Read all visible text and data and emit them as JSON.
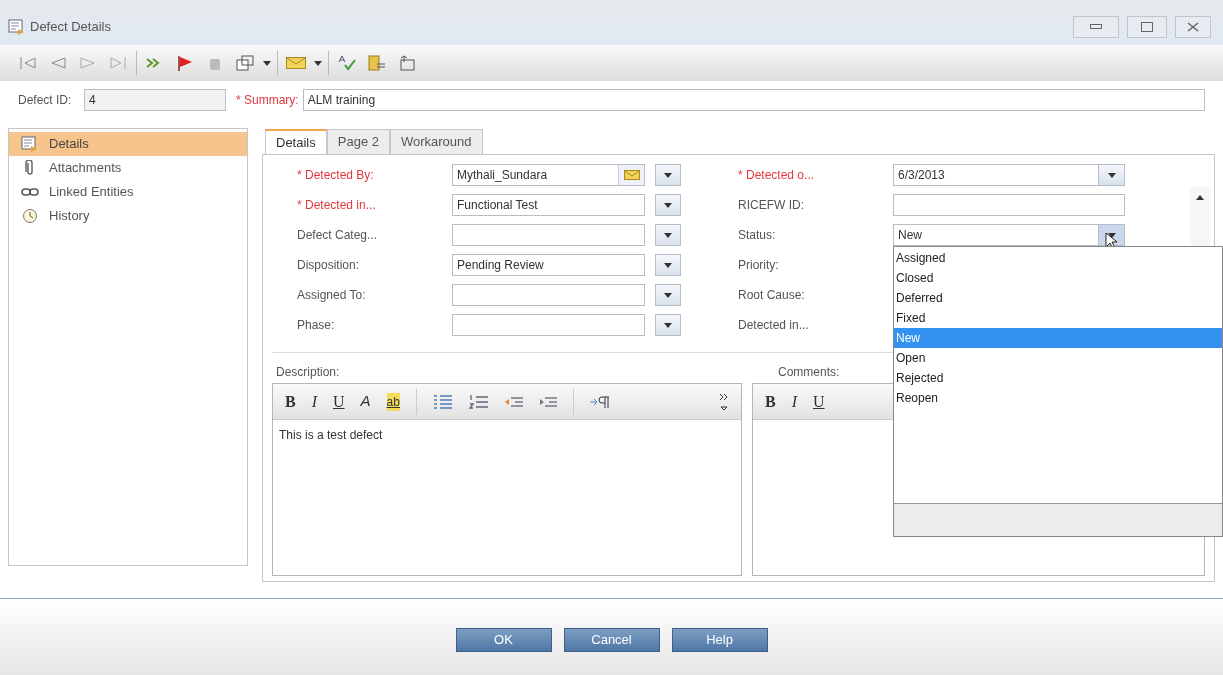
{
  "window": {
    "title": "Defect Details"
  },
  "header": {
    "id_label": "Defect ID:",
    "id_value": "4",
    "summary_label": "* Summary:",
    "summary_value": "ALM training"
  },
  "sidebar": {
    "items": [
      {
        "label": "Details",
        "kind": "details",
        "selected": true
      },
      {
        "label": "Attachments",
        "kind": "attachment",
        "selected": false
      },
      {
        "label": "Linked Entities",
        "kind": "link",
        "selected": false
      },
      {
        "label": "History",
        "kind": "history",
        "selected": false
      }
    ]
  },
  "tabs": [
    {
      "label": "Details",
      "selected": true
    },
    {
      "label": "Page 2",
      "selected": false
    },
    {
      "label": "Workaround",
      "selected": false
    }
  ],
  "left_fields": [
    {
      "label": "* Detected By:",
      "required": true,
      "kind": "user",
      "value": "Mythali_Sundara"
    },
    {
      "label": "* Detected in...",
      "required": true,
      "kind": "dropdown",
      "value": "Functional Test"
    },
    {
      "label": "Defect Categ...",
      "required": false,
      "kind": "dropdown"
    },
    {
      "label": "Disposition:",
      "required": false,
      "kind": "dropdown",
      "value": "Pending Review"
    },
    {
      "label": "Assigned To:",
      "required": false,
      "kind": "dropdown"
    },
    {
      "label": "Phase:",
      "required": false,
      "kind": "dropdown"
    }
  ],
  "right_fields": [
    {
      "label": "* Detected o...",
      "required": true,
      "kind": "dropdown",
      "value": "6/3/2013"
    },
    {
      "label": "RICEFW ID:",
      "required": false,
      "kind": "text"
    },
    {
      "label": "Status:",
      "required": false,
      "kind": "open_dropdown",
      "value": "New"
    },
    {
      "label": "Priority:",
      "required": false,
      "kind": "hidden"
    },
    {
      "label": "Root Cause:",
      "required": false,
      "kind": "hidden"
    },
    {
      "label": "Detected in...",
      "required": false,
      "kind": "hidden"
    }
  ],
  "status_options": [
    {
      "label": "Assigned",
      "selected": false
    },
    {
      "label": "Closed",
      "selected": false
    },
    {
      "label": "Deferred",
      "selected": false
    },
    {
      "label": "Fixed",
      "selected": false
    },
    {
      "label": "New",
      "selected": true
    },
    {
      "label": "Open",
      "selected": false
    },
    {
      "label": "Rejected",
      "selected": false
    },
    {
      "label": "Reopen",
      "selected": false
    }
  ],
  "description": {
    "label": "Description:",
    "toolbar": [
      "B",
      "I",
      "U",
      "A",
      "ab"
    ],
    "text": "This is a test defect"
  },
  "comments": {
    "label": "Comments:",
    "toolbar": [
      "B",
      "I",
      "U"
    ]
  },
  "buttons": [
    "OK",
    "Cancel",
    "Help"
  ]
}
